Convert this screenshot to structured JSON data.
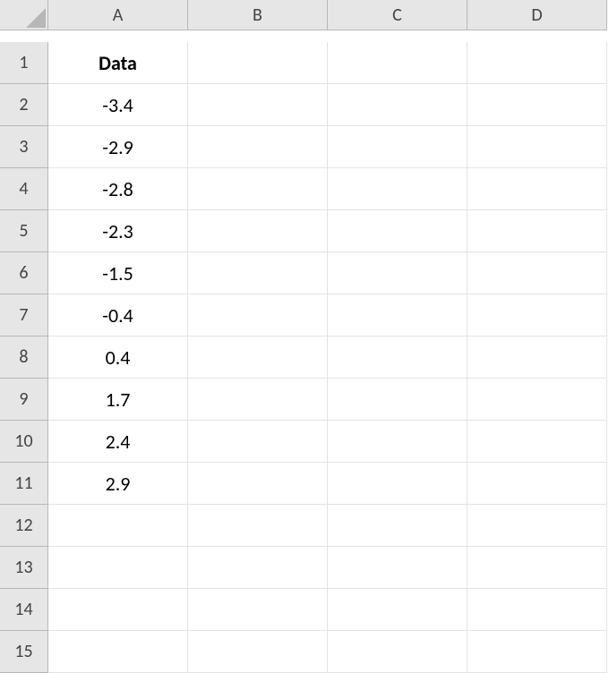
{
  "columns": [
    "A",
    "B",
    "C",
    "D"
  ],
  "row_count": 15,
  "header_label": "Data",
  "cells": {
    "A1": "Data",
    "A2": "-3.4",
    "A3": "-2.9",
    "A4": "-2.8",
    "A5": "-2.3",
    "A6": "-1.5",
    "A7": "-0.4",
    "A8": "0.4",
    "A9": "1.7",
    "A10": "2.4",
    "A11": "2.9"
  },
  "colors": {
    "header_bg": "#e6e6e6",
    "grid_border": "#e3e3e3",
    "header_border": "#b7b7b7"
  }
}
